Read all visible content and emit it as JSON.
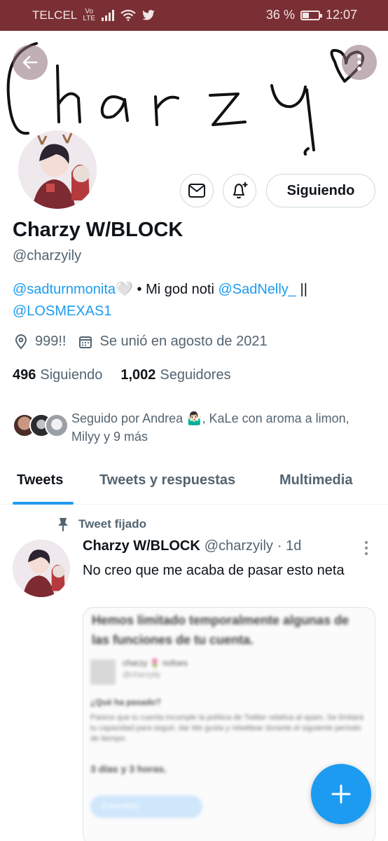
{
  "status_bar": {
    "carrier": "TELCEL",
    "network": "Vo LTE",
    "battery": "36 %",
    "time": "12:07"
  },
  "banner": {
    "handwriting": "Charzy"
  },
  "profile": {
    "name": "Charzy W/BLOCK",
    "handle": "@charzyily",
    "follow_label": "Siguiendo",
    "bio": {
      "mention1": "@sadturnmonita",
      "heart": "🤍",
      "text": " • Mi god noti ",
      "mention2": "@SadNelly_",
      "separator": " ||",
      "mention3": "@LOSMEXAS1"
    },
    "location": "999!!",
    "joined": "Se unió en agosto de 2021",
    "following_count": "496",
    "following_label": "Siguiendo",
    "followers_count": "1,002",
    "followers_label": "Seguidores",
    "followed_by": "Seguido por Andrea 🤷🏻‍♂️, KaLe con aroma a limon, Milyy y 9 más"
  },
  "tabs": [
    {
      "label": "Tweets",
      "active": true
    },
    {
      "label": "Tweets y respuestas",
      "active": false
    },
    {
      "label": "Multimedia",
      "active": false
    }
  ],
  "pinned_tweet": {
    "pinned_label": "Tweet fijado",
    "author": "Charzy W/BLOCK",
    "handle": "@charzyily",
    "time": "· 1d",
    "text": "No creo que me acaba de pasar esto neta",
    "media_blurred": {
      "title": "Hemos limitado temporalmente algunas de las funciones de tu cuenta.",
      "user": "charzy 🌷 nofoes",
      "user_handle": "@charzyily",
      "question": "¿Qué ha pasado?",
      "body": "Parece que tu cuenta incumple la política de Twitter relativa al spam. Se limitará tu capacidad para seguir, dar Me gusta y retwittear durante el siguiente período de tiempo:",
      "duration": "3 días y 3 horas.",
      "button": "Entendido"
    }
  },
  "colors": {
    "status_bar": "#7a2f34",
    "accent": "#1d9bf0",
    "text": "#0f1419",
    "muted": "#536471"
  },
  "icons": [
    "back-arrow-icon",
    "more-vertical-icon",
    "mail-icon",
    "bell-plus-icon",
    "location-pin-icon",
    "calendar-icon",
    "pin-icon",
    "plus-icon"
  ]
}
